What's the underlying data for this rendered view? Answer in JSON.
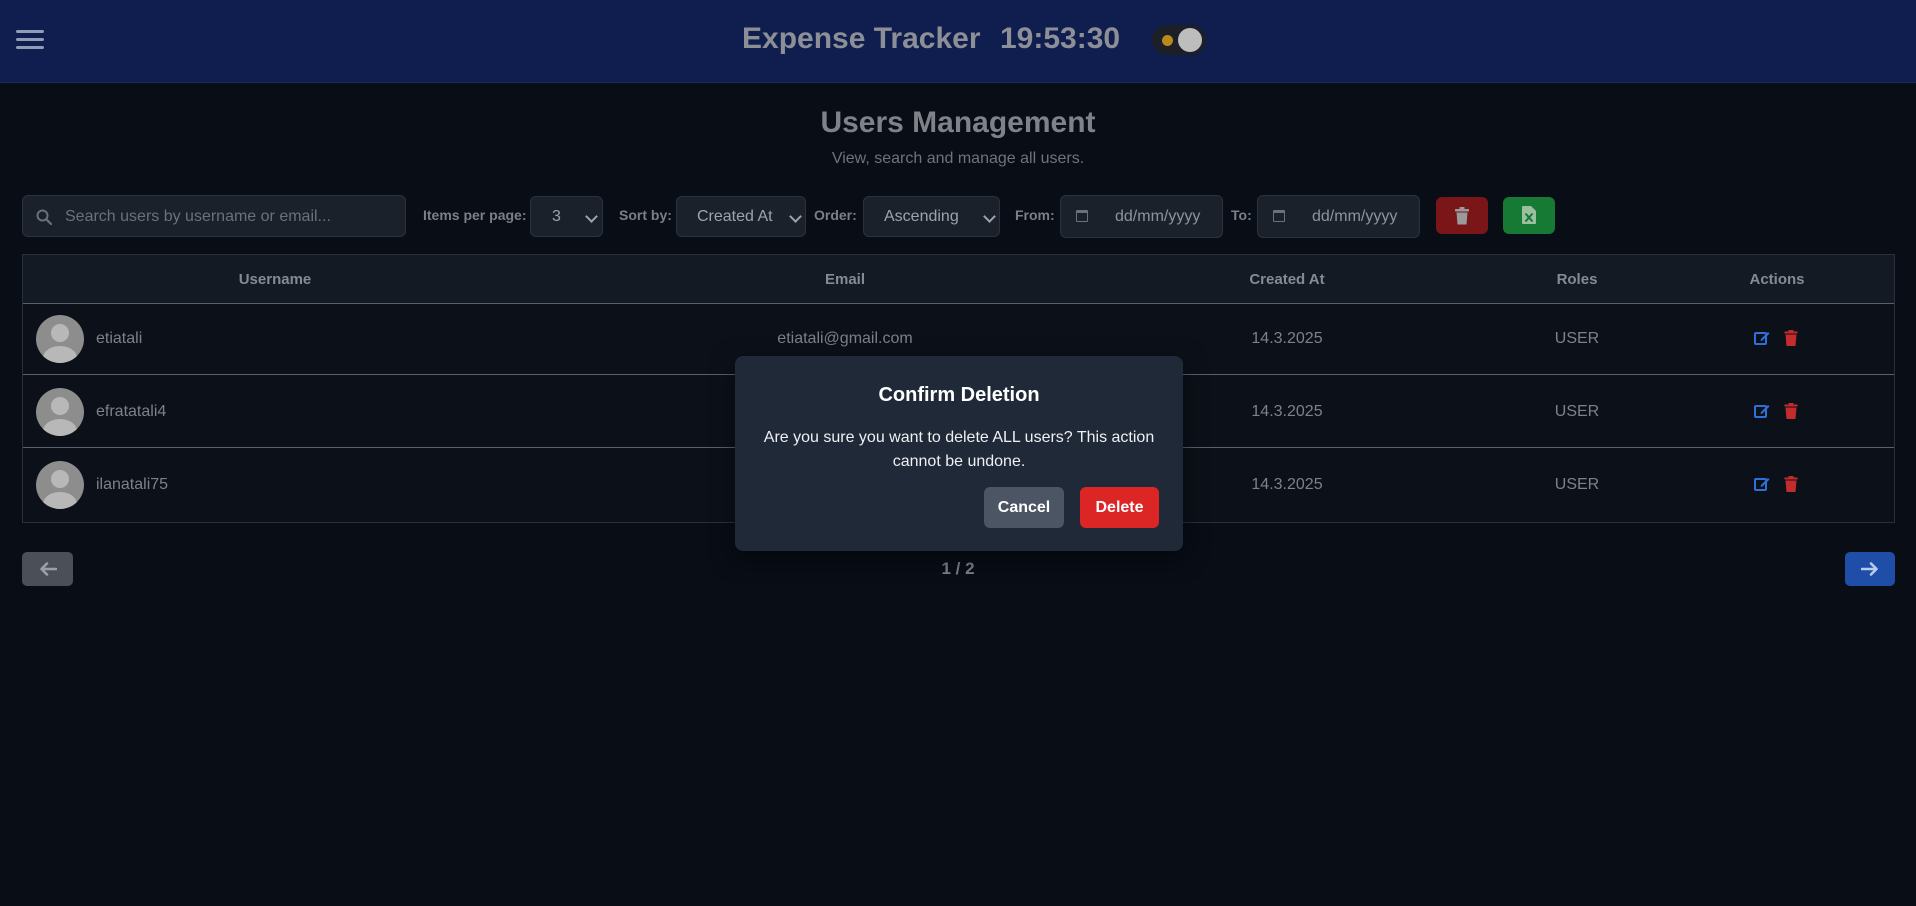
{
  "header": {
    "app_title": "Expense Tracker",
    "clock": "19:53:30"
  },
  "page": {
    "title": "Users Management",
    "subtitle": "View, search and manage all users."
  },
  "toolbar": {
    "search_placeholder": "Search users by username or email...",
    "items_per_page_label": "Items per page:",
    "items_per_page_value": "3",
    "sort_by_label": "Sort by:",
    "sort_by_value": "Created At",
    "order_label": "Order:",
    "order_value": "Ascending",
    "from_label": "From:",
    "from_value": "dd/mm/yyyy",
    "to_label": "To:",
    "to_value": "dd/mm/yyyy"
  },
  "table": {
    "columns": [
      "Username",
      "Email",
      "Created At",
      "Roles",
      "Actions"
    ],
    "rows": [
      {
        "username": "etiatali",
        "email": "etiatali@gmail.com",
        "created_at": "14.3.2025",
        "role": "USER"
      },
      {
        "username": "efratatali4",
        "email": "",
        "created_at": "14.3.2025",
        "role": "USER"
      },
      {
        "username": "ilanatali75",
        "email": "",
        "created_at": "14.3.2025",
        "role": "USER"
      }
    ]
  },
  "pagination": {
    "text": "1 / 2"
  },
  "modal": {
    "title": "Confirm Deletion",
    "message": "Are you sure you want to delete ALL users? This action cannot be undone.",
    "cancel_label": "Cancel",
    "delete_label": "Delete"
  },
  "colors": {
    "topbar": "#0f1e4f",
    "background": "#080d16",
    "danger": "#dc2626",
    "excel": "#167a35",
    "primary": "#1f4ea8"
  },
  "icons": [
    "menu-icon",
    "theme-toggle-icon",
    "search-icon",
    "calendar-icon",
    "trash-icon",
    "excel-icon",
    "edit-icon",
    "arrow-left-icon",
    "arrow-right-icon",
    "user-avatar-icon"
  ]
}
